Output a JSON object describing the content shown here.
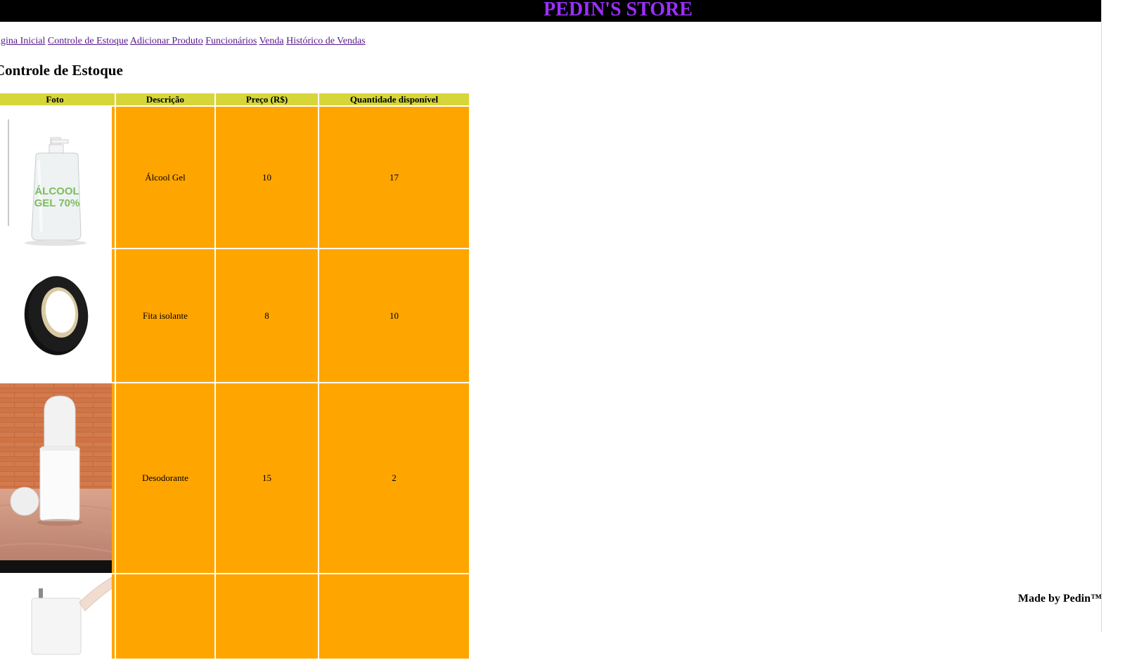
{
  "header": {
    "title": "PEDIN'S STORE"
  },
  "nav": {
    "items": [
      {
        "label": "Página Inicial"
      },
      {
        "label": "Controle de Estoque"
      },
      {
        "label": "Adicionar Produto"
      },
      {
        "label": "Funcionários"
      },
      {
        "label": "Venda"
      },
      {
        "label": "Histórico de Vendas"
      }
    ]
  },
  "page": {
    "heading": "Controle de Estoque"
  },
  "table": {
    "headers": [
      "Foto",
      "Descrição",
      "Preço (R$)",
      "Quantidade disponível"
    ],
    "rows": [
      {
        "photo": "alcool-gel-photo",
        "description": "Álcool Gel",
        "price": "10",
        "quantity": "17",
        "photo_text_1": "ÁLCOOL",
        "photo_text_2": "GEL 70%"
      },
      {
        "photo": "fita-isolante-photo",
        "description": "Fita isolante",
        "price": "8",
        "quantity": "10"
      },
      {
        "photo": "desodorante-photo",
        "description": "Desodorante",
        "price": "15",
        "quantity": "2"
      },
      {
        "photo": "paper-towel-photo",
        "description": "",
        "price": "",
        "quantity": ""
      }
    ]
  },
  "footer": {
    "credit": "Made by Pedin™"
  },
  "colors": {
    "header_bg": "#000000",
    "title": "#9b30ff",
    "th_bg": "#d6d63a",
    "td_bg": "#ffa500",
    "link": "#551a8b"
  }
}
